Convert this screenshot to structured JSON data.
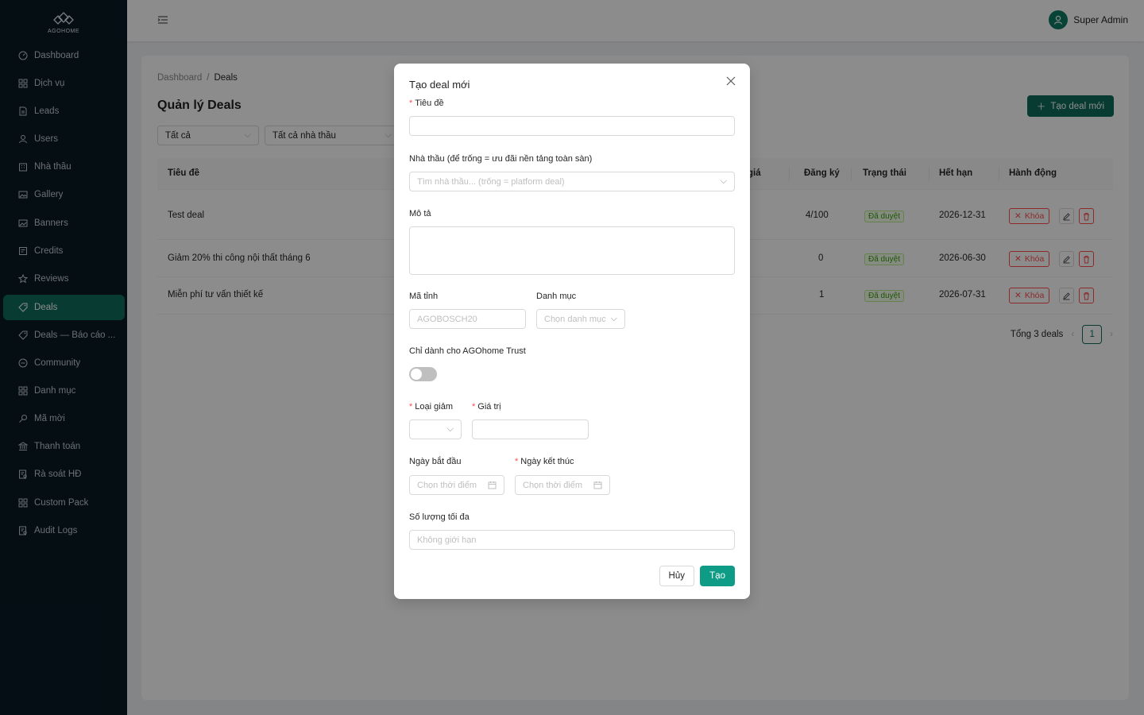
{
  "brand": {
    "logo_text": "AGOHOME",
    "accent": "#0f6e5e"
  },
  "sidebar": {
    "items": [
      {
        "label": "Dashboard",
        "icon": "dashboard-icon"
      },
      {
        "label": "Dịch vụ",
        "icon": "grid-icon"
      },
      {
        "label": "Leads",
        "icon": "file-icon"
      },
      {
        "label": "Users",
        "icon": "user-icon"
      },
      {
        "label": "Nhà thầu",
        "icon": "building-icon"
      },
      {
        "label": "Gallery",
        "icon": "image-icon"
      },
      {
        "label": "Banners",
        "icon": "picture-icon"
      },
      {
        "label": "Credits",
        "icon": "credit-icon"
      },
      {
        "label": "Reviews",
        "icon": "star-icon"
      },
      {
        "label": "Deals",
        "icon": "tag-icon"
      },
      {
        "label": "Deals — Báo cáo ...",
        "icon": "tag-icon"
      },
      {
        "label": "Community",
        "icon": "message-icon"
      },
      {
        "label": "Danh mục",
        "icon": "grid-icon"
      },
      {
        "label": "Mã mời",
        "icon": "key-icon"
      },
      {
        "label": "Thanh toán",
        "icon": "bank-icon"
      },
      {
        "label": "Rà soát HĐ",
        "icon": "audit-icon"
      },
      {
        "label": "Custom Pack",
        "icon": "grid-icon"
      },
      {
        "label": "Audit Logs",
        "icon": "audit-icon"
      }
    ],
    "active_label": "Deals"
  },
  "header": {
    "user_name": "Super Admin"
  },
  "breadcrumb": {
    "root": "Dashboard",
    "separator": "/",
    "current": "Deals"
  },
  "page": {
    "title": "Quản lý Deals",
    "create_button": "Tạo deal mới",
    "filters": {
      "status": "Tất cả",
      "contractor": "Tất cả nhà thầu"
    }
  },
  "table": {
    "columns": {
      "title": "Tiêu đề",
      "price_partial": "giá",
      "registered": "Đăng ký",
      "status": "Trạng thái",
      "expires": "Hết hạn",
      "actions": "Hành động"
    },
    "rows": [
      {
        "title": "Test deal",
        "registered": "4/100",
        "status": "Đã duyệt",
        "expires": "2026-12-31"
      },
      {
        "title": "Giảm 20% thi công nội thất tháng 6",
        "registered": "0",
        "status": "Đã duyệt",
        "expires": "2026-06-30"
      },
      {
        "title": "Miễn phí tư vấn thiết kế",
        "registered": "1",
        "status": "Đã duyệt",
        "expires": "2026-07-31"
      }
    ],
    "lock_label": "Khóa",
    "total_label": "Tổng 3 deals",
    "current_page": "1"
  },
  "modal": {
    "title": "Tạo deal mới",
    "fields": {
      "title_label": "Tiêu đề",
      "title_value": "",
      "contractor_label": "Nhà thầu (để trống = ưu đãi nền tảng toàn sàn)",
      "contractor_placeholder": "Tìm nhà thầu... (trống = platform deal)",
      "description_label": "Mô tả",
      "promo_code_label": "Mã tỉnh",
      "promo_code_placeholder": "AGOBOSCH20",
      "category_label": "Danh mục",
      "category_placeholder": "Chọn danh mục",
      "trust_only_label": "Chỉ dành cho AGOhome Trust",
      "discount_type_label": "Loại giảm",
      "value_label": "Giá trị",
      "start_date_label": "Ngày bắt đầu",
      "start_date_placeholder": "Chọn thời điểm",
      "end_date_label": "Ngày kết thúc",
      "end_date_placeholder": "Chọn thời điểm",
      "max_qty_label": "Số lượng tối đa",
      "max_qty_placeholder": "Không giới hạn"
    },
    "cancel_label": "Hủy",
    "submit_label": "Tạo"
  }
}
